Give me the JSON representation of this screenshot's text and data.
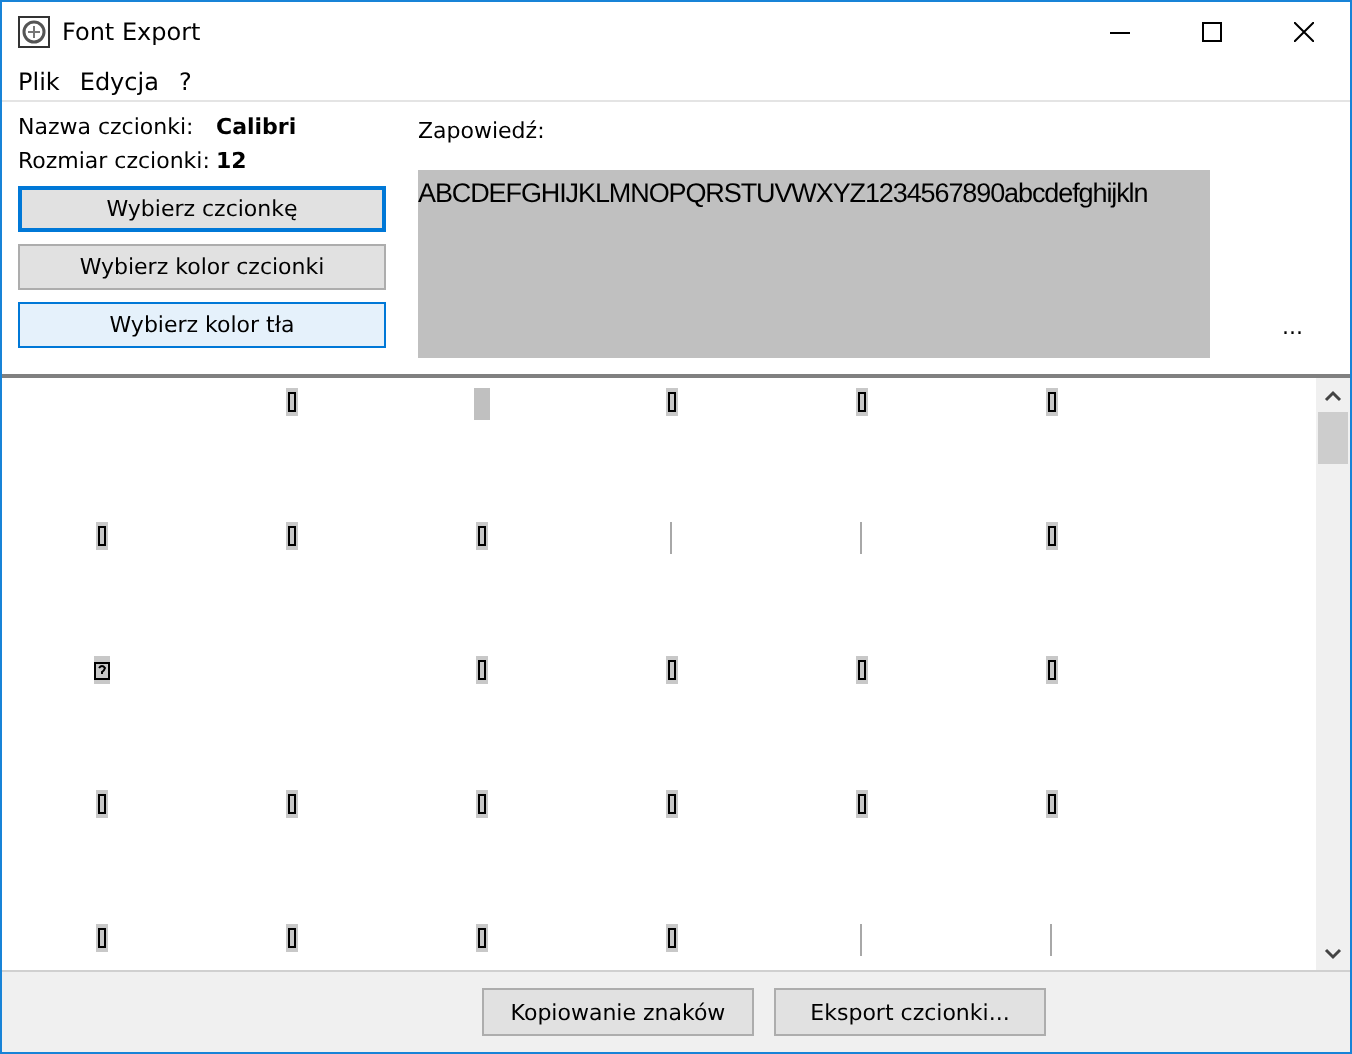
{
  "window": {
    "title": "Font Export"
  },
  "menu": [
    "Plik",
    "Edycja",
    "?"
  ],
  "font_info": [
    {
      "label": "Nazwa czcionki:",
      "value": "Calibri"
    },
    {
      "label": "Rozmiar czcionki:",
      "value": "12"
    }
  ],
  "buttons": [
    {
      "label": "Wybierz czcionkę",
      "kind": "focused"
    },
    {
      "label": "Wybierz kolor czcionki",
      "kind": "normal"
    },
    {
      "label": "Wybierz kolor tła",
      "kind": "hover"
    }
  ],
  "preview": {
    "label": "Zapowiedź:",
    "text": "ABCDEFGHIJKLMNOPQRSTUVWXYZ1234567890abcdefghijkln",
    "more": "..."
  },
  "glyph_grid": [
    {
      "cells": [
        {
          "kind": "blank"
        },
        {
          "kind": "box"
        },
        {
          "kind": "block"
        },
        {
          "kind": "box"
        },
        {
          "kind": "box"
        },
        {
          "kind": "box"
        }
      ]
    },
    {
      "cells": [
        {
          "kind": "box"
        },
        {
          "kind": "box"
        },
        {
          "kind": "box"
        },
        {
          "kind": "line"
        },
        {
          "kind": "line"
        },
        {
          "kind": "box"
        }
      ]
    },
    {
      "cells": [
        {
          "kind": "question"
        },
        {
          "kind": "blank"
        },
        {
          "kind": "box"
        },
        {
          "kind": "box"
        },
        {
          "kind": "box"
        },
        {
          "kind": "box"
        }
      ]
    },
    {
      "cells": [
        {
          "kind": "box"
        },
        {
          "kind": "box"
        },
        {
          "kind": "box"
        },
        {
          "kind": "box"
        },
        {
          "kind": "box"
        },
        {
          "kind": "box"
        }
      ]
    },
    {
      "cells": [
        {
          "kind": "box"
        },
        {
          "kind": "box"
        },
        {
          "kind": "box"
        },
        {
          "kind": "box"
        },
        {
          "kind": "line"
        },
        {
          "kind": "line"
        }
      ]
    }
  ],
  "footer_buttons": [
    "Kopiowanie znaków",
    "Eksport czcionki..."
  ]
}
